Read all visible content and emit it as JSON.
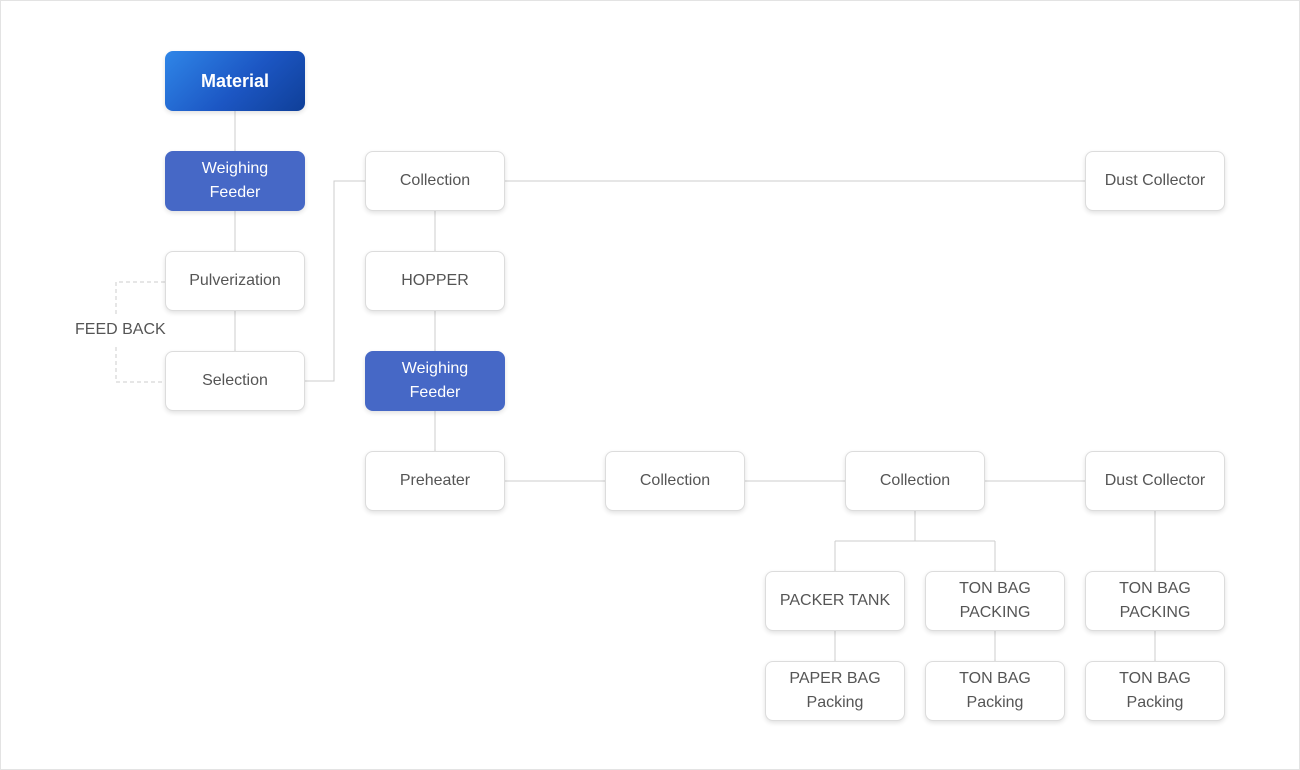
{
  "diagram": {
    "feedback_label": "FEED BACK",
    "nodes": {
      "material": "Material",
      "weighing_feeder_1": "Weighing\nFeeder",
      "pulverization": "Pulverization",
      "selection": "Selection",
      "collection_top": "Collection",
      "dust_collector_top": "Dust Collector",
      "hopper": "HOPPER",
      "weighing_feeder_2": "Weighing\nFeeder",
      "preheater": "Preheater",
      "collection_mid_1": "Collection",
      "collection_mid_2": "Collection",
      "dust_collector_bottom": "Dust Collector",
      "packer_tank": "PACKER TANK",
      "ton_bag_packing_1": "TON BAG\nPACKING",
      "ton_bag_packing_2": "TON BAG\nPACKING",
      "paper_bag_packing": "PAPER BAG\nPacking",
      "ton_bag_packing_lower_1": "TON BAG\nPacking",
      "ton_bag_packing_lower_2": "TON BAG\nPacking"
    }
  },
  "colors": {
    "node_blue": "#4668c6",
    "gradient_start": "#2f86e8",
    "gradient_end": "#0f3f98",
    "connector": "#cccccc",
    "text": "#555555"
  }
}
